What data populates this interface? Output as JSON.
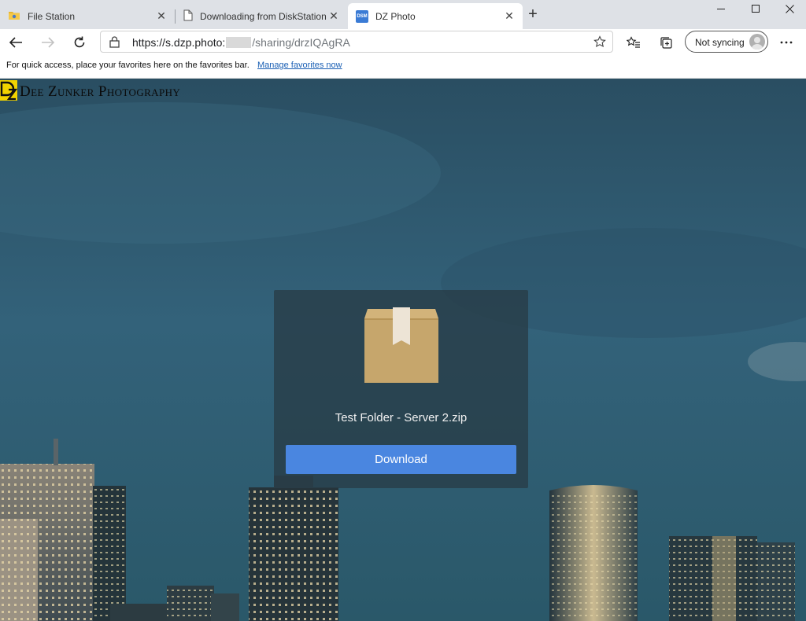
{
  "browser": {
    "tabs": [
      {
        "title": "File Station",
        "icon": "file-station-icon",
        "active": false
      },
      {
        "title": "Downloading from DiskStation",
        "icon": "page-icon",
        "active": false
      },
      {
        "title": "DZ Photo",
        "icon": "dsm-icon",
        "active": true
      }
    ],
    "dsm_icon_text": "DSM",
    "address": {
      "url_host": "https://s.dzp.photo:",
      "url_path": "/sharing/drzIQAgRA"
    },
    "sync_label": "Not syncing",
    "favorites_bar": {
      "message": "For quick access, place your favorites here on the favorites bar.",
      "link": "Manage favorites now"
    }
  },
  "page": {
    "logo_text": "Dee Zunker Photography",
    "file_name": "Test Folder - Server 2.zip",
    "download_label": "Download"
  },
  "colors": {
    "download_button": "#4a86e0",
    "tabstrip": "#dee1e6",
    "logo_accent": "#f2d300"
  }
}
